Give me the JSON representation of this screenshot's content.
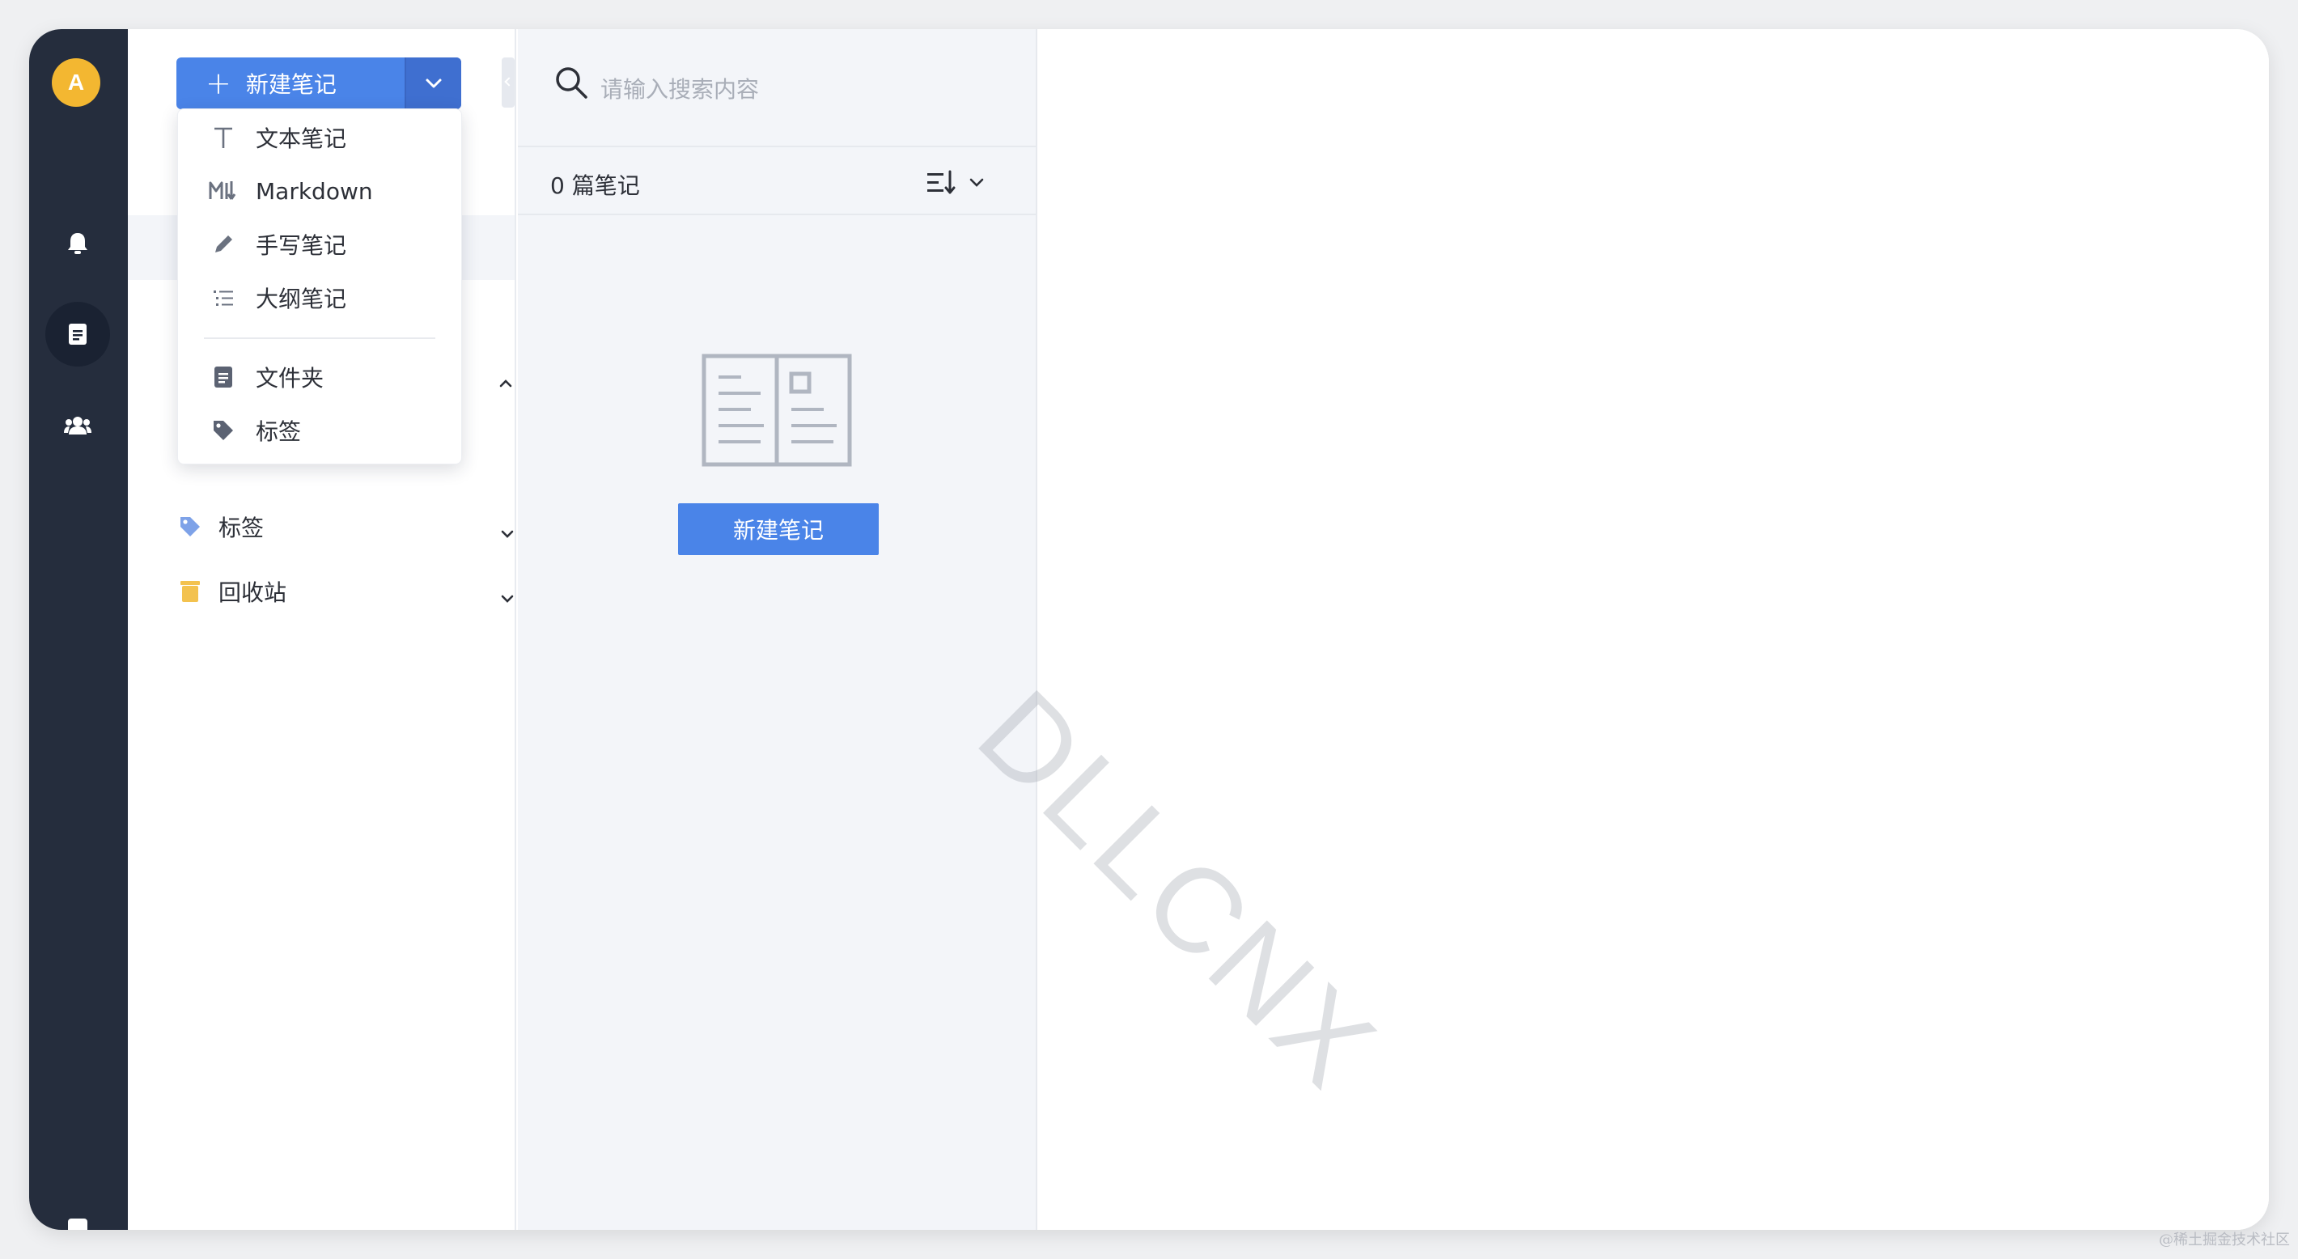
{
  "user": {
    "avatar_initial": "A"
  },
  "new_note": {
    "label": "新建笔记",
    "plus": "+"
  },
  "menu": {
    "items": [
      {
        "label": "文本笔记",
        "icon": "text-icon"
      },
      {
        "label": "Markdown",
        "icon": "markdown-icon"
      },
      {
        "label": "手写笔记",
        "icon": "pen-icon"
      },
      {
        "label": "大纲笔记",
        "icon": "outline-list-icon"
      },
      {
        "label": "文件夹",
        "icon": "folder-doc-icon"
      },
      {
        "label": "标签",
        "icon": "tag-icon"
      }
    ]
  },
  "sidebar": {
    "items": [
      {
        "label": "标签",
        "icon": "tag-icon",
        "color": "#7ea2e8"
      },
      {
        "label": "回收站",
        "icon": "trash-icon",
        "color": "#f3c24f"
      }
    ]
  },
  "search": {
    "placeholder": "请输入搜索内容"
  },
  "list": {
    "count_label": "0 篇笔记"
  },
  "empty": {
    "button_label": "新建笔记"
  },
  "watermark": "DLLCNX",
  "site_mark": "@稀土掘金技术社区",
  "colors": {
    "accent": "#4a84e8",
    "rail": "#252d3d",
    "avatar": "#f3b731"
  }
}
